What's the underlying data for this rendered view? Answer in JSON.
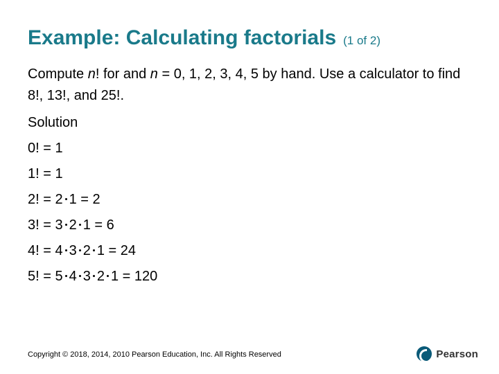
{
  "title": "Example: Calculating factorials",
  "subtitle": "(1 of 2)",
  "prompt_prefix": "Compute ",
  "prompt_var": "n",
  "prompt_mid1": "! for and ",
  "prompt_mid2": " = 0, 1, 2, 3, 4, 5 by hand. Use a calculator to find 8!, 13!, and 25!.",
  "solution_label": "Solution",
  "rows": {
    "r0": {
      "lhs": "0! = 1"
    },
    "r1": {
      "lhs": "1! = 1"
    },
    "r2": {
      "a": "2! = 2",
      "b": "1 = 2"
    },
    "r3": {
      "a": "3! = 3",
      "b": "2",
      "c": "1 = 6"
    },
    "r4": {
      "a": "4! = 4",
      "b": "3",
      "c": "2",
      "d": "1 = 24"
    },
    "r5": {
      "a": "5! = 5",
      "b": "4",
      "c": "3",
      "d": "2",
      "e": "1 = 120"
    }
  },
  "footer": "Copyright © 2018, 2014, 2010 Pearson Education, Inc. All Rights Reserved",
  "logo_text": "Pearson"
}
